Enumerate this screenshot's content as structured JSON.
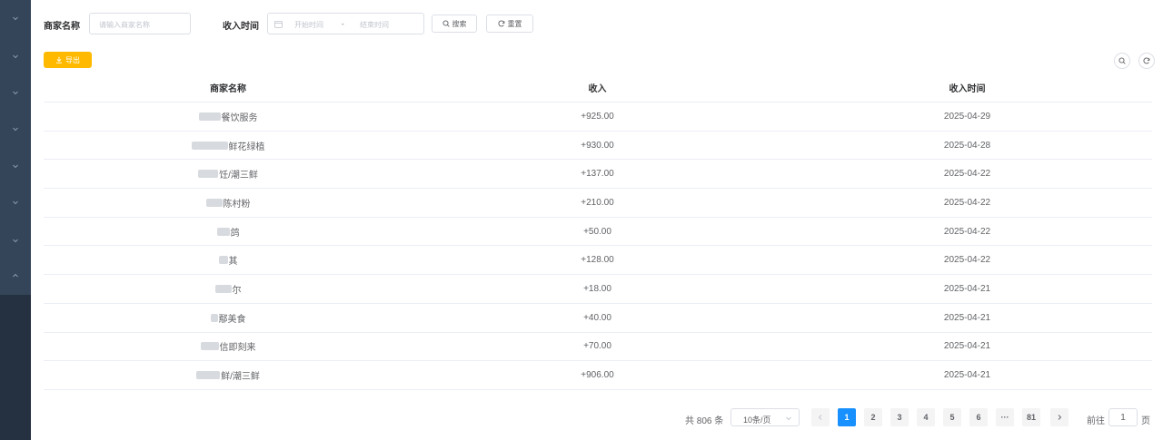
{
  "search": {
    "merchant_label": "商家名称",
    "merchant_placeholder": "请输入商家名称",
    "time_label": "收入时间",
    "start_placeholder": "开始时间",
    "range_sep": "-",
    "end_placeholder": "结束时间",
    "search_button": "搜索",
    "reset_button": "重置"
  },
  "toolbar": {
    "export_button": "导出"
  },
  "colors": {
    "export": "#ffba00",
    "sidebar": "#344559",
    "sidebar_dark": "#253140",
    "active_page": "#1890ff"
  },
  "table": {
    "columns": [
      "商家名称",
      "收入",
      "收入时间"
    ],
    "rows": [
      {
        "name": "餐饮服务",
        "amount": "+925.00",
        "date": "2025-04-29"
      },
      {
        "name": "鲜花绿植",
        "amount": "+930.00",
        "date": "2025-04-28"
      },
      {
        "name": "饪/潮三鲜",
        "amount": "+137.00",
        "date": "2025-04-22"
      },
      {
        "name": "陈村粉",
        "amount": "+210.00",
        "date": "2025-04-22"
      },
      {
        "name": "鸽",
        "amount": "+50.00",
        "date": "2025-04-22"
      },
      {
        "name": "其",
        "amount": "+128.00",
        "date": "2025-04-22"
      },
      {
        "name": "尔",
        "amount": "+18.00",
        "date": "2025-04-21"
      },
      {
        "name": "鄢美食",
        "amount": "+40.00",
        "date": "2025-04-21"
      },
      {
        "name": "信即刻来",
        "amount": "+70.00",
        "date": "2025-04-21"
      },
      {
        "name": "鲜/潮三鲜",
        "amount": "+906.00",
        "date": "2025-04-21"
      }
    ]
  },
  "pagination": {
    "total_text": "共 806 条",
    "page_size": "10条/页",
    "pages": [
      "1",
      "2",
      "3",
      "4",
      "5",
      "6",
      "···",
      "81"
    ],
    "current": "1",
    "goto_prefix": "前往",
    "goto_value": "1",
    "goto_suffix": "页"
  }
}
